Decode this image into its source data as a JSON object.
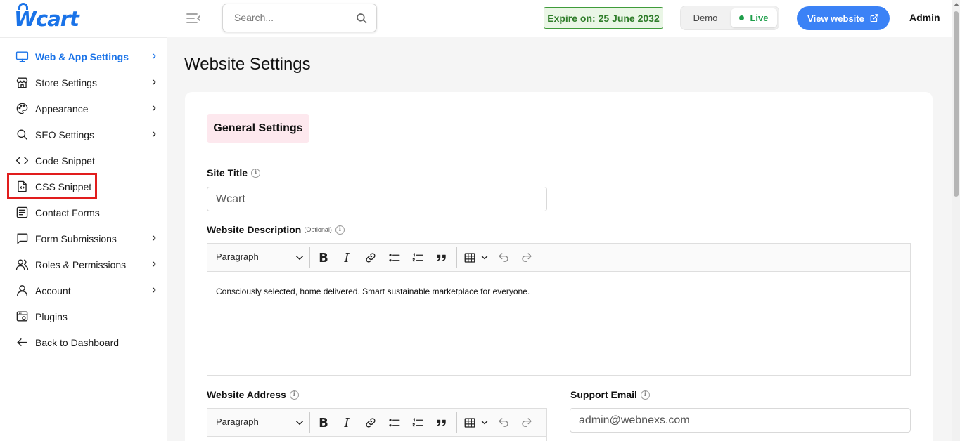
{
  "app": {
    "logo_text": "cart"
  },
  "sidebar": {
    "items": [
      {
        "label": "Web & App Settings",
        "icon": "monitor-icon"
      },
      {
        "label": "Store Settings",
        "icon": "store-icon"
      },
      {
        "label": "Appearance",
        "icon": "palette-icon"
      },
      {
        "label": "SEO Settings",
        "icon": "search-icon"
      },
      {
        "label": "Code Snippet",
        "icon": "code-icon"
      },
      {
        "label": "CSS Snippet",
        "icon": "css-file-icon"
      },
      {
        "label": "Contact Forms",
        "icon": "form-icon"
      },
      {
        "label": "Form Submissions",
        "icon": "message-icon"
      },
      {
        "label": "Roles & Permissions",
        "icon": "users-icon"
      },
      {
        "label": "Account",
        "icon": "user-icon"
      },
      {
        "label": "Plugins",
        "icon": "plugin-icon"
      },
      {
        "label": "Back to Dashboard",
        "icon": "arrow-left-icon"
      }
    ]
  },
  "header": {
    "search_placeholder": "Search...",
    "expire_text": "Expire on: 25 June 2032",
    "mode_demo": "Demo",
    "mode_live": "Live",
    "view_website": "View website",
    "user": "Admin"
  },
  "main": {
    "page_title": "Website Settings",
    "section_tab": "General Settings",
    "site_title_label": "Site Title",
    "site_title_value": "Wcart",
    "description_label": "Website Description",
    "optional_text": "(Optional)",
    "paragraph_label": "Paragraph",
    "description_value": "Consciously selected, home delivered. Smart sustainable marketplace for everyone.",
    "address_label": "Website Address",
    "support_email_label": "Support Email",
    "support_email_value": "admin@webnexs.com"
  },
  "colors": {
    "accent": "#1a73e8",
    "button": "#3b82f6",
    "expire_bg": "#eaf6e6",
    "live": "#1e9e4a",
    "tab_bg": "#fde8ee",
    "highlight": "#e11d1d"
  }
}
